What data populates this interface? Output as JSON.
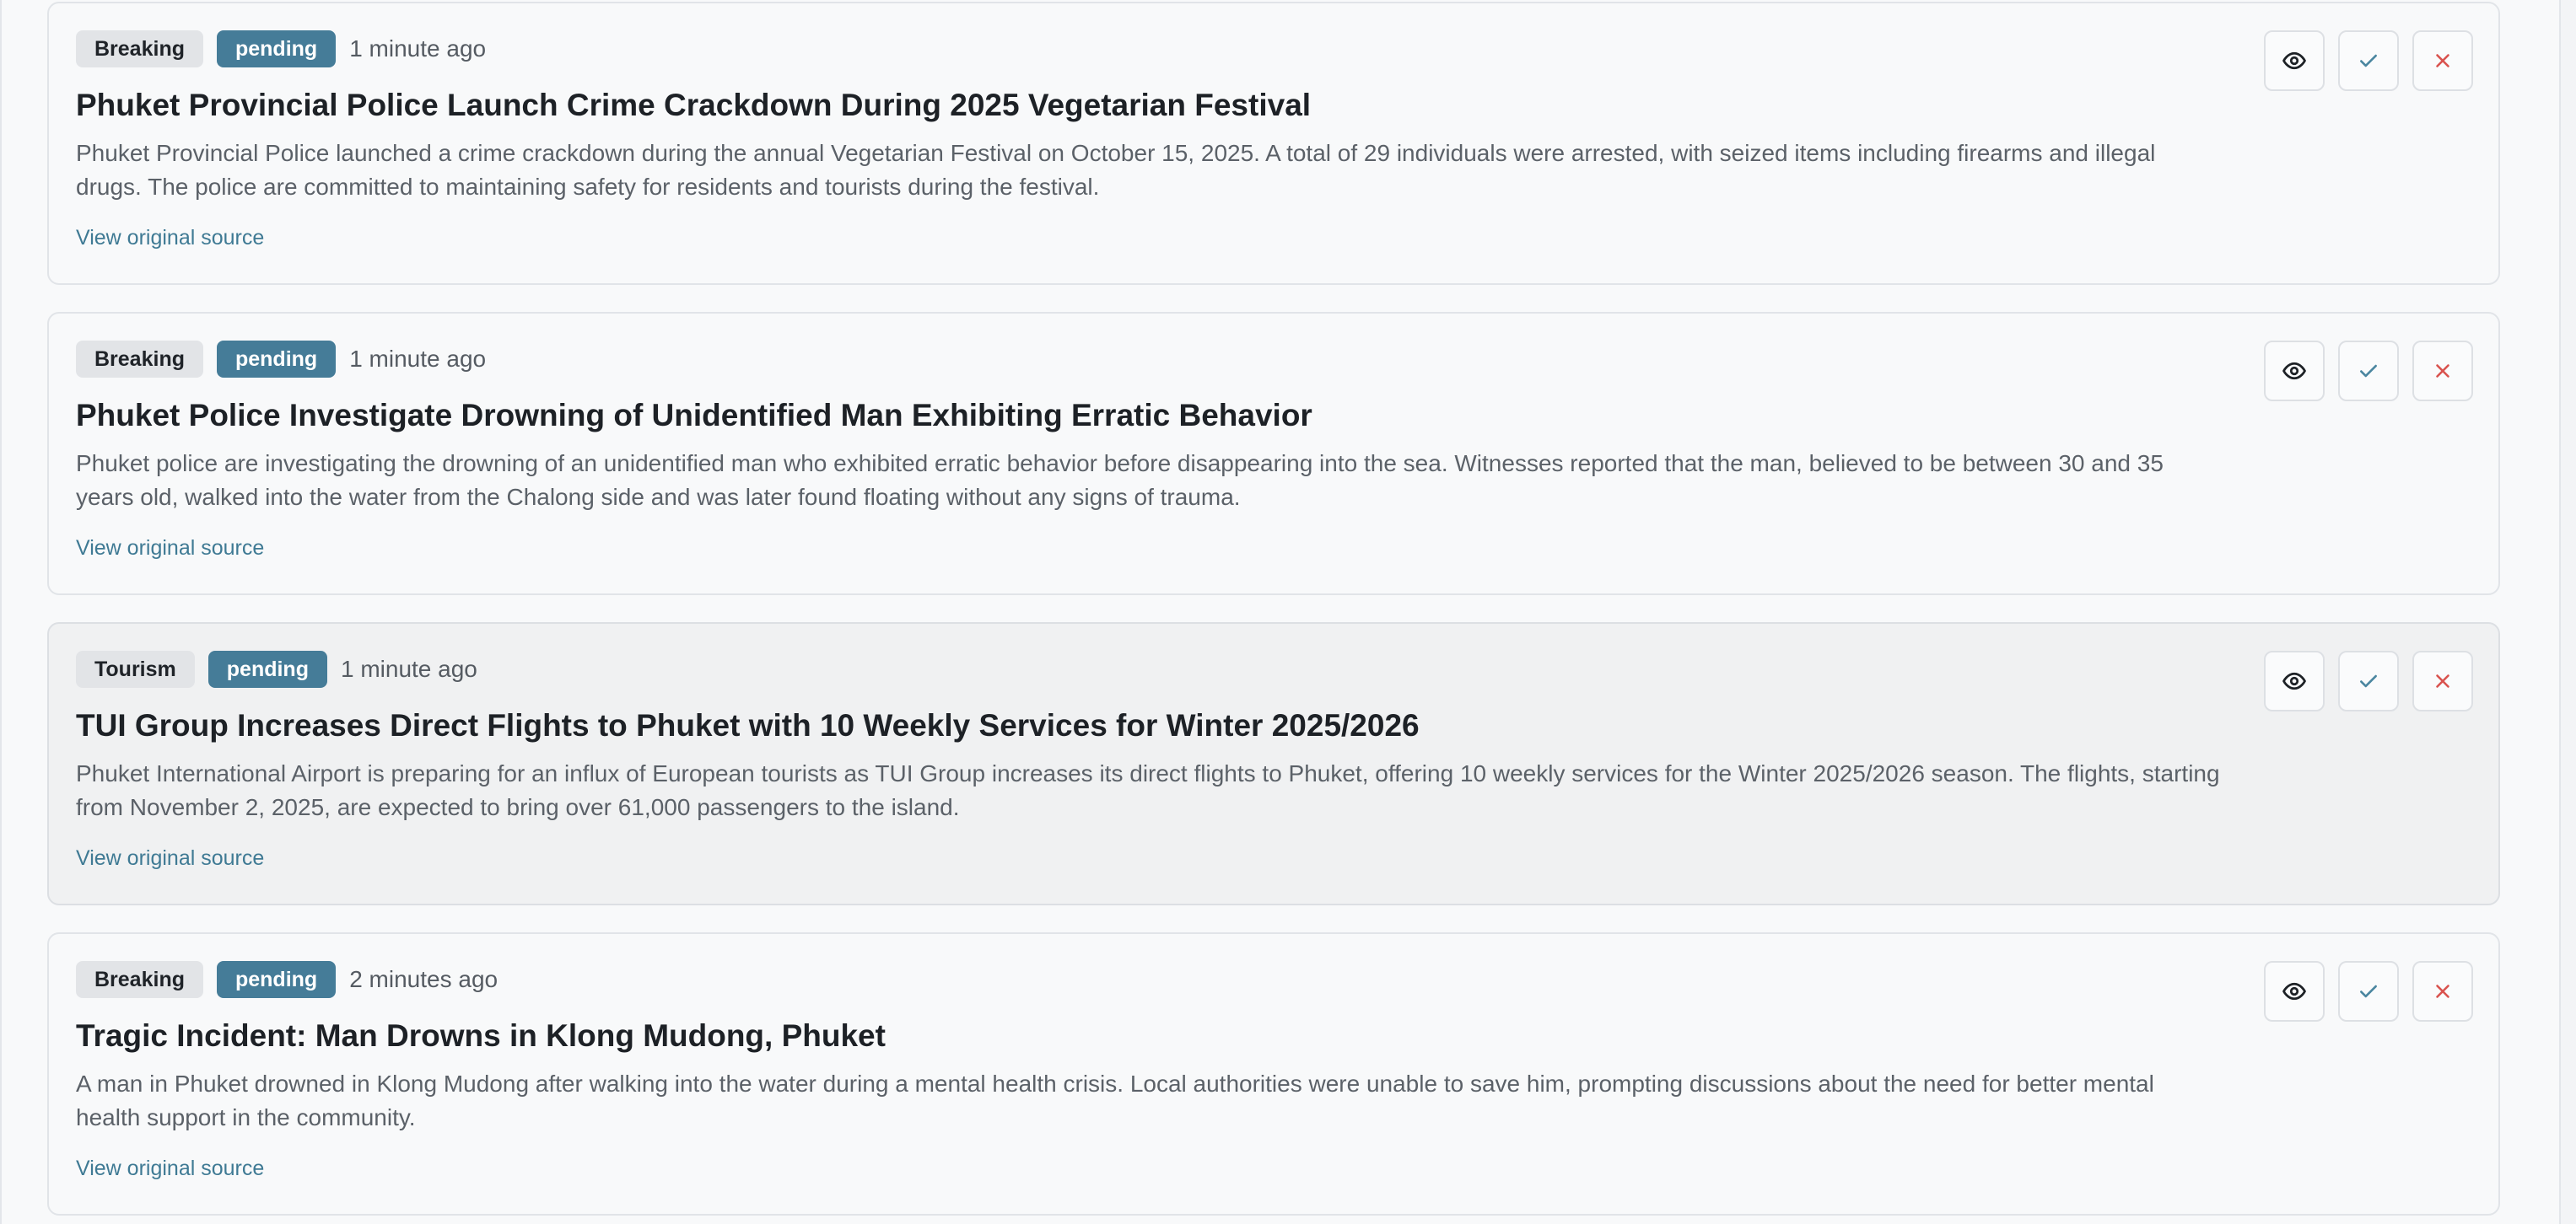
{
  "articles": [
    {
      "category": "Breaking",
      "status": "pending",
      "time": "1 minute ago",
      "title": "Phuket Provincial Police Launch Crime Crackdown During 2025 Vegetarian Festival",
      "summary": "Phuket Provincial Police launched a crime crackdown during the annual Vegetarian Festival on October 15, 2025. A total of 29 individuals were arrested, with seized items including firearms and illegal drugs. The police are committed to maintaining safety for residents and tourists during the festival.",
      "source_label": "View original source"
    },
    {
      "category": "Breaking",
      "status": "pending",
      "time": "1 minute ago",
      "title": "Phuket Police Investigate Drowning of Unidentified Man Exhibiting Erratic Behavior",
      "summary": "Phuket police are investigating the drowning of an unidentified man who exhibited erratic behavior before disappearing into the sea. Witnesses reported that the man, believed to be between 30 and 35 years old, walked into the water from the Chalong side and was later found floating without any signs of trauma.",
      "source_label": "View original source"
    },
    {
      "category": "Tourism",
      "status": "pending",
      "time": "1 minute ago",
      "title": "TUI Group Increases Direct Flights to Phuket with 10 Weekly Services for Winter 2025/2026",
      "summary": "Phuket International Airport is preparing for an influx of European tourists as TUI Group increases its direct flights to Phuket, offering 10 weekly services for the Winter 2025/2026 season. The flights, starting from November 2, 2025, are expected to bring over 61,000 passengers to the island.",
      "source_label": "View original source"
    },
    {
      "category": "Breaking",
      "status": "pending",
      "time": "2 minutes ago",
      "title": "Tragic Incident: Man Drowns in Klong Mudong, Phuket",
      "summary": "A man in Phuket drowned in Klong Mudong after walking into the water during a mental health crisis. Local authorities were unable to save him, prompting discussions about the need for better mental health support in the community.",
      "source_label": "View original source"
    }
  ],
  "actions": {
    "view_icon": "eye-icon",
    "approve_icon": "check-icon",
    "reject_icon": "x-icon"
  },
  "colors": {
    "status_badge": "#457c98",
    "link": "#3f7a94",
    "approve": "#4a86a0",
    "reject": "#d9534f"
  }
}
